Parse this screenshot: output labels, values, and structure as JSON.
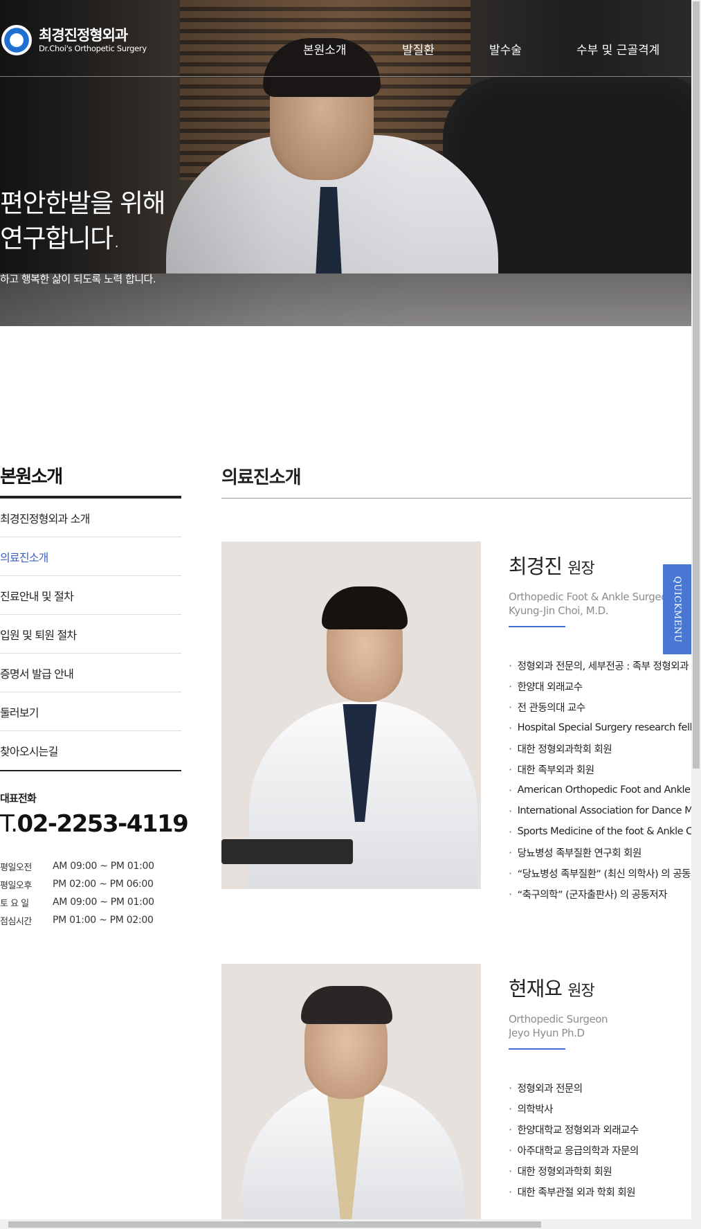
{
  "header": {
    "logo_title": "최경진정형외과",
    "logo_sub": "Dr.Choi's Orthopetic Surgery",
    "nav": [
      {
        "label": "본원소개"
      },
      {
        "label": "발질환"
      },
      {
        "label": "발수술"
      },
      {
        "label": "수부 및 근골격계"
      }
    ]
  },
  "hero": {
    "line1": "편안한발을 위해",
    "line2": "연구합니다.",
    "sub": "하고 행복한 삶이 되도록 노력 합니다."
  },
  "sidebar": {
    "title": "본원소개",
    "items": [
      {
        "label": "최경진정형외과 소개"
      },
      {
        "label": "의료진소개"
      },
      {
        "label": "진료안내 및 절차"
      },
      {
        "label": "입원 및 퇴원 절차"
      },
      {
        "label": "증명서 발급 안내"
      },
      {
        "label": "둘러보기"
      },
      {
        "label": "찾아오시는길"
      }
    ],
    "phone_label": "대표전화",
    "phone_prefix": "T.",
    "phone_number": "02-2253-4119",
    "hours": [
      {
        "label": "평일오전",
        "time": "AM 09:00 ~ PM 01:00"
      },
      {
        "label": "평일오후",
        "time": "PM 02:00 ~ PM 06:00"
      },
      {
        "label": "토 요 일",
        "time": "AM 09:00 ~ PM 01:00"
      },
      {
        "label": "점심시간",
        "time": "PM 01:00 ~ PM 02:00"
      }
    ]
  },
  "main": {
    "title": "의료진소개",
    "doctors": [
      {
        "name": "최경진",
        "role": "원장",
        "en_title": "Orthopedic Foot & Ankle Surgeon",
        "en_name": "Kyung-Jin Choi, M.D.",
        "creds": [
          "정형외과 전문의, 세부전공 : 족부 정형외과",
          "한양대 외래교수",
          "전 관동의대 교수",
          "Hospital Special Surgery research fellow",
          "대한 정형외과학회 회원",
          "대한 족부외과 회원",
          "American Orthopedic Foot and Ankle Society",
          "International Association for Dance Medicine",
          "Sports Medicine of the foot & Ankle Course",
          "당뇨병성 족부질환 연구회 회원",
          "“당뇨병성 족부질환” (최신 의학사) 의 공동저자",
          "“축구의학” (군자출판사) 의 공동저자"
        ]
      },
      {
        "name": "현재요",
        "role": "원장",
        "en_title": "Orthopedic Surgeon",
        "en_name": "Jeyo Hyun Ph.D",
        "creds": [
          "정형외과 전문의",
          "의학박사",
          "한양대학교 정형외과 외래교수",
          "아주대학교 응급의학과 자문의",
          "대한 정형외과학회 회원",
          "대한 족부관절 외과 학회 회원"
        ]
      }
    ]
  },
  "quickmenu_label": "QUICKMENU",
  "colors": {
    "accent": "#3d5fc4",
    "quickmenu": "#4978d4",
    "divider": "#222222"
  }
}
